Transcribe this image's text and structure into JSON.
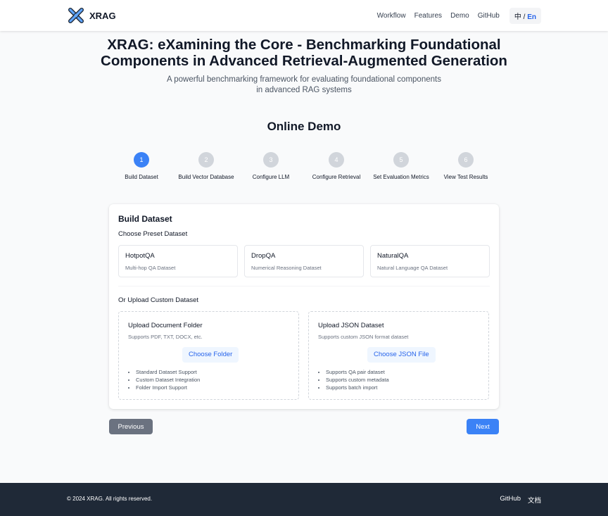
{
  "header": {
    "brand": "XRAG",
    "nav": [
      "Workflow",
      "Features",
      "Demo",
      "GitHub"
    ],
    "lang_zh": "中",
    "lang_sep": " / ",
    "lang_en": "En"
  },
  "hero": {
    "title_line1": "XRAG: eXamining the Core - Benchmarking Foundational",
    "title_line2": "Components in Advanced Retrieval-Augmented Generation",
    "subtitle_line1": "A powerful benchmarking framework for evaluating foundational components",
    "subtitle_line2": "in advanced RAG systems"
  },
  "demo": {
    "title": "Online Demo",
    "steps": [
      {
        "number": "1",
        "label": "Build Dataset",
        "active": true
      },
      {
        "number": "2",
        "label": "Build Vector Database",
        "active": false
      },
      {
        "number": "3",
        "label": "Configure LLM",
        "active": false
      },
      {
        "number": "4",
        "label": "Configure Retrieval",
        "active": false
      },
      {
        "number": "5",
        "label": "Set Evaluation Metrics",
        "active": false
      },
      {
        "number": "6",
        "label": "View Test Results",
        "active": false
      }
    ]
  },
  "card": {
    "title": "Build Dataset",
    "preset_heading": "Choose Preset Dataset",
    "presets": [
      {
        "name": "HotpotQA",
        "desc": "Multi-hop QA Dataset"
      },
      {
        "name": "DropQA",
        "desc": "Numerical Reasoning Dataset"
      },
      {
        "name": "NaturalQA",
        "desc": "Natural Language QA Dataset"
      }
    ],
    "upload_heading": "Or Upload Custom Dataset",
    "uploads": [
      {
        "title": "Upload Document Folder",
        "desc": "Supports PDF, TXT, DOCX, etc.",
        "button": "Choose Folder",
        "features": [
          "Standard Dataset Support",
          "Custom Dataset Integration",
          "Folder Import Support"
        ]
      },
      {
        "title": "Upload JSON Dataset",
        "desc": "Supports custom JSON format dataset",
        "button": "Choose JSON File",
        "features": [
          "Supports QA pair dataset",
          "Supports custom metadata",
          "Supports batch import"
        ]
      }
    ]
  },
  "buttons": {
    "previous": "Previous",
    "next": "Next"
  },
  "footer": {
    "copyright": "© 2024 XRAG. All rights reserved.",
    "links": [
      "GitHub",
      "文档"
    ]
  },
  "colors": {
    "primary": "#3b82f6",
    "primary_text": "#2563eb",
    "step_inactive": "#d1d5db",
    "secondary_button": "#6b7280",
    "footer_bg": "#1f2937",
    "page_bg": "#f9fafb"
  },
  "icons": {
    "brand_logo": "x-logo-icon"
  }
}
